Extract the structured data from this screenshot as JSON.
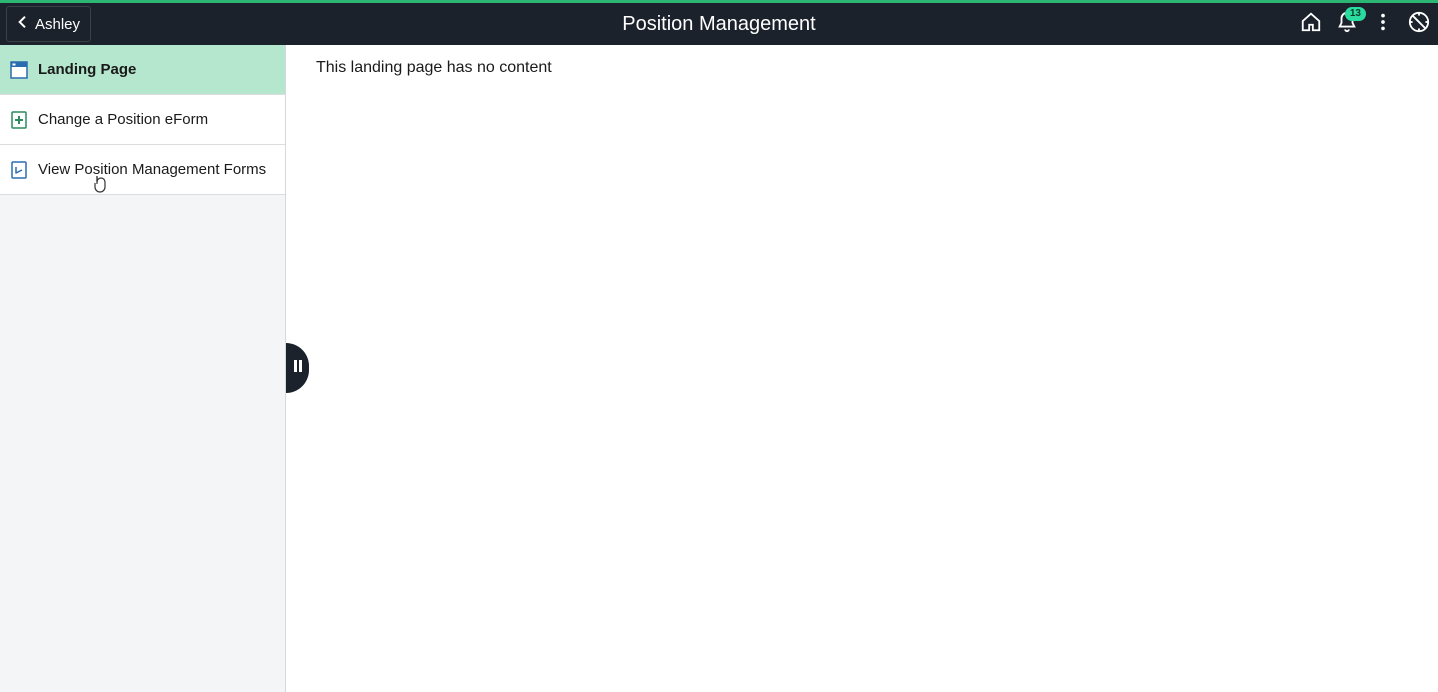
{
  "header": {
    "back_label": "Ashley",
    "title": "Position Management",
    "notification_count": "13"
  },
  "sidebar": {
    "items": [
      {
        "label": "Landing Page"
      },
      {
        "label": "Change a Position eForm"
      },
      {
        "label": "View Position Management Forms"
      }
    ]
  },
  "main": {
    "content": "This landing page has no content"
  }
}
